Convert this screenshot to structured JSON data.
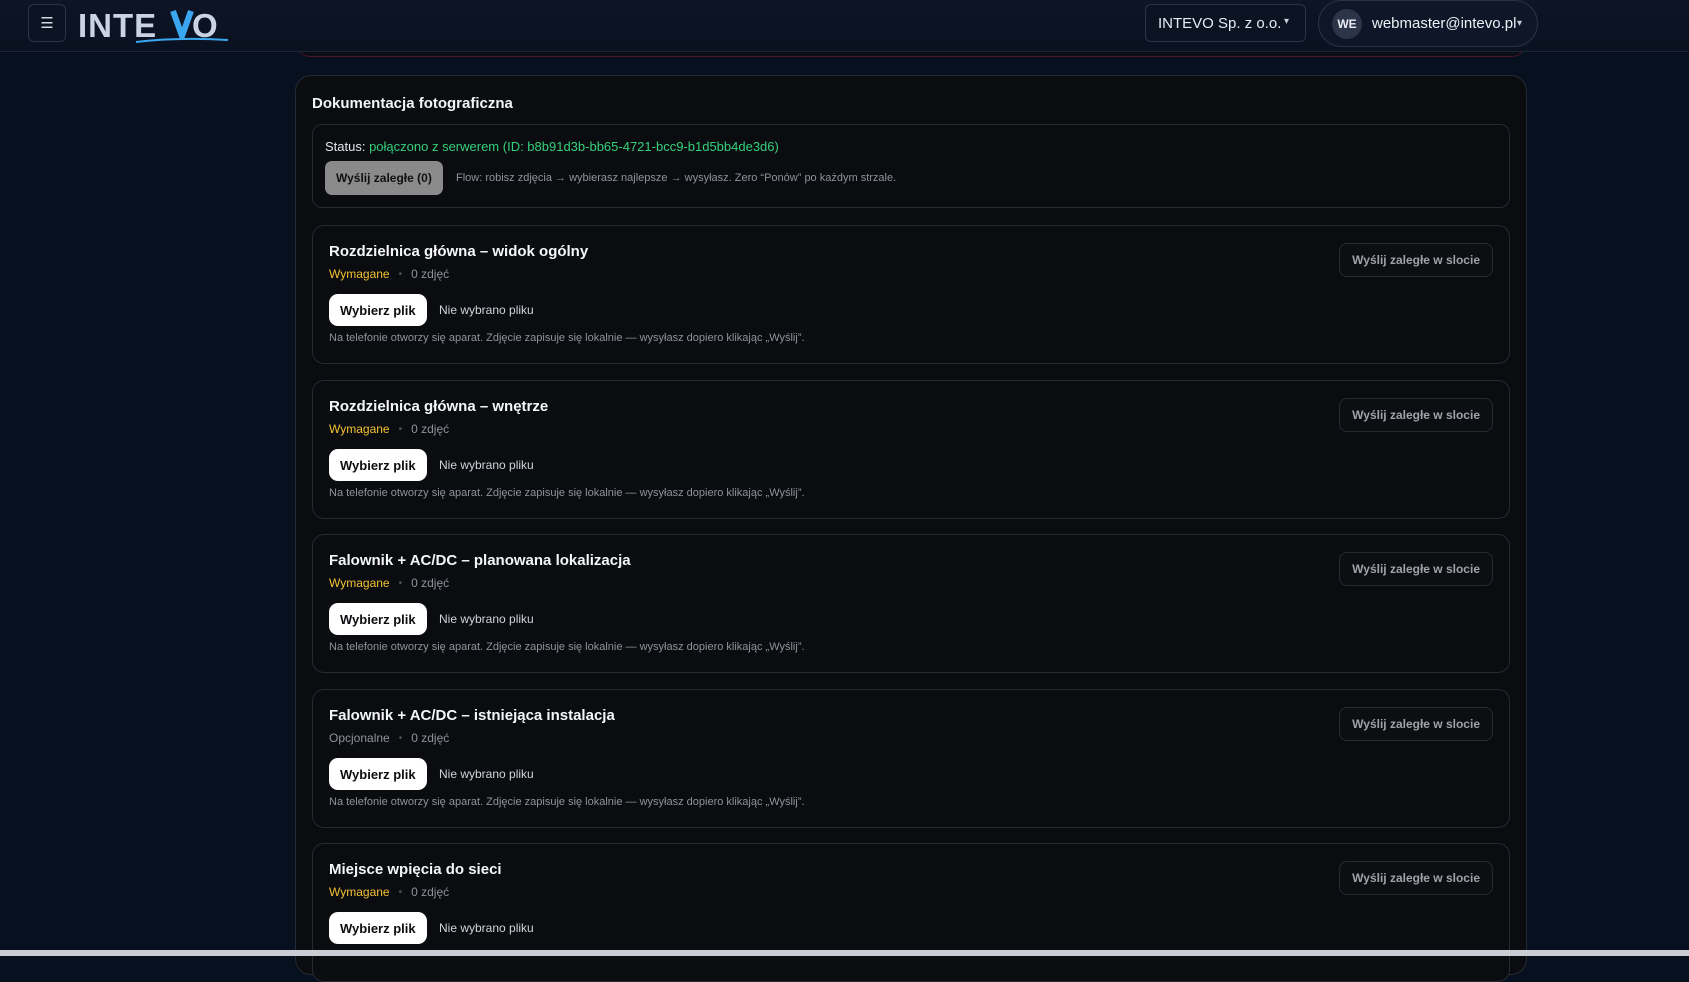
{
  "header": {
    "menu_icon_glyph": "☰",
    "logo_text": "INTEVO",
    "company": "INTEVO Sp. z o.o.",
    "user_initials": "WE",
    "user_email": "webmaster@intevo.pl",
    "chevron": "▾"
  },
  "panel": {
    "title": "Dokumentacja fotograficzna",
    "status_label": "Status: ",
    "status_value": "połączono z serwerem (ID: b8b91d3b-bb65-4721-bcc9-b1d5bb4de3d6)",
    "send_all_label": "Wyślij zaległe (0)",
    "flow_text": "Flow: robisz zdjęcia → wybierasz najlepsze → wysyłasz. Zero “Ponów” po każdym strzale."
  },
  "slots": [
    {
      "title": "Rozdzielnica główna – widok ogólny",
      "requirement": "Wymagane",
      "photo_count": "0 zdjęć",
      "choose_label": "Wybierz plik",
      "file_status": "Nie wybrano pliku",
      "hint": "Na telefonie otworzy się aparat. Zdjęcie zapisuje się lokalnie — wysyłasz dopiero klikając „Wyślij”.",
      "send_label": "Wyślij zaległe w slocie"
    },
    {
      "title": "Rozdzielnica główna – wnętrze",
      "requirement": "Wymagane",
      "photo_count": "0 zdjęć",
      "choose_label": "Wybierz plik",
      "file_status": "Nie wybrano pliku",
      "hint": "Na telefonie otworzy się aparat. Zdjęcie zapisuje się lokalnie — wysyłasz dopiero klikając „Wyślij”.",
      "send_label": "Wyślij zaległe w slocie"
    },
    {
      "title": "Falownik + AC/DC – planowana lokalizacja",
      "requirement": "Wymagane",
      "photo_count": "0 zdjęć",
      "choose_label": "Wybierz plik",
      "file_status": "Nie wybrano pliku",
      "hint": "Na telefonie otworzy się aparat. Zdjęcie zapisuje się lokalnie — wysyłasz dopiero klikając „Wyślij”.",
      "send_label": "Wyślij zaległe w slocie"
    },
    {
      "title": "Falownik + AC/DC – istniejąca instalacja",
      "requirement": "Opcjonalne",
      "photo_count": "0 zdjęć",
      "choose_label": "Wybierz plik",
      "file_status": "Nie wybrano pliku",
      "hint": "Na telefonie otworzy się aparat. Zdjęcie zapisuje się lokalnie — wysyłasz dopiero klikając „Wyślij”.",
      "send_label": "Wyślij zaległe w slocie"
    },
    {
      "title": "Miejsce wpięcia do sieci",
      "requirement": "Wymagane",
      "photo_count": "0 zdjęć",
      "choose_label": "Wybierz plik",
      "file_status": "Nie wybrano pliku",
      "hint": "",
      "send_label": "Wyślij zaległe w slocie"
    }
  ],
  "colors": {
    "required": "#f2c232",
    "optional": "#8e939c",
    "status_ok": "#34d17c"
  }
}
